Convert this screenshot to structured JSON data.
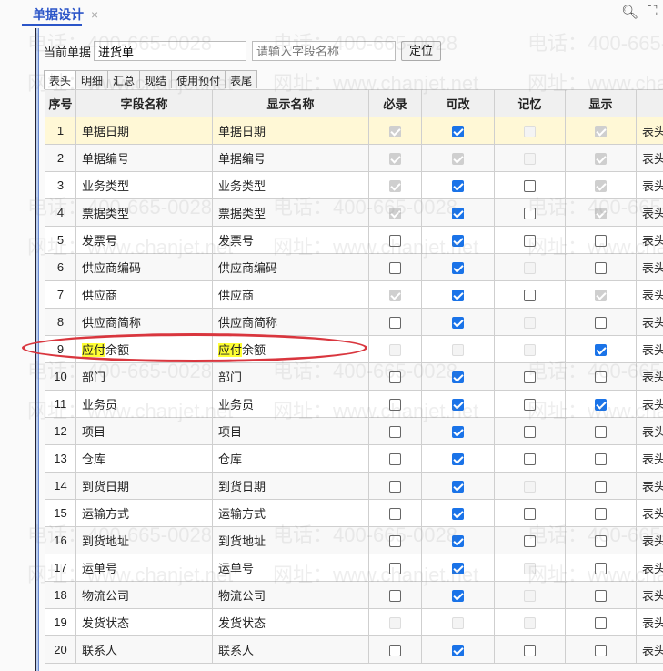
{
  "tab": {
    "title": "单据设计",
    "close": "×"
  },
  "toolbar": {
    "search_icon": "search-icon",
    "fullscreen_icon": "fullscreen-icon"
  },
  "form": {
    "label": "当前单据",
    "doc_value": "进货单",
    "field_placeholder": "请输入字段名称",
    "locate_button": "定位"
  },
  "subtabs": [
    "表头",
    "明细",
    "汇总",
    "现结",
    "使用预付",
    "表尾"
  ],
  "columns": [
    "序号",
    "字段名称",
    "显示名称",
    "必录",
    "可改",
    "记忆",
    "显示",
    ""
  ],
  "rows": [
    {
      "no": "1",
      "field": "单据日期",
      "display": "单据日期",
      "req": "dc",
      "edit": "c",
      "mem": "du",
      "show": "dc",
      "pos": "表头"
    },
    {
      "no": "2",
      "field": "单据编号",
      "display": "单据编号",
      "req": "dc",
      "edit": "dc",
      "mem": "du",
      "show": "dc",
      "pos": "表头"
    },
    {
      "no": "3",
      "field": "业务类型",
      "display": "业务类型",
      "req": "dc",
      "edit": "c",
      "mem": "u",
      "show": "dc",
      "pos": "表头"
    },
    {
      "no": "4",
      "field": "票据类型",
      "display": "票据类型",
      "req": "dc",
      "edit": "c",
      "mem": "u",
      "show": "dc",
      "pos": "表头"
    },
    {
      "no": "5",
      "field": "发票号",
      "display": "发票号",
      "req": "u",
      "edit": "c",
      "mem": "u",
      "show": "u",
      "pos": "表头"
    },
    {
      "no": "6",
      "field": "供应商编码",
      "display": "供应商编码",
      "req": "u",
      "edit": "c",
      "mem": "du",
      "show": "u",
      "pos": "表头"
    },
    {
      "no": "7",
      "field": "供应商",
      "display": "供应商",
      "req": "dc",
      "edit": "c",
      "mem": "u",
      "show": "dc",
      "pos": "表头"
    },
    {
      "no": "8",
      "field": "供应商简称",
      "display": "供应商简称",
      "req": "u",
      "edit": "c",
      "mem": "du",
      "show": "u",
      "pos": "表头"
    },
    {
      "no": "9",
      "field": "应付余额",
      "display": "应付余额",
      "highlight": "应付",
      "req": "du",
      "edit": "du",
      "mem": "du",
      "show": "c",
      "pos": "表头"
    },
    {
      "no": "10",
      "field": "部门",
      "display": "部门",
      "req": "u",
      "edit": "c",
      "mem": "u",
      "show": "u",
      "pos": "表头"
    },
    {
      "no": "11",
      "field": "业务员",
      "display": "业务员",
      "req": "u",
      "edit": "c",
      "mem": "u",
      "show": "c",
      "pos": "表头"
    },
    {
      "no": "12",
      "field": "项目",
      "display": "项目",
      "req": "u",
      "edit": "c",
      "mem": "u",
      "show": "u",
      "pos": "表头"
    },
    {
      "no": "13",
      "field": "仓库",
      "display": "仓库",
      "req": "u",
      "edit": "c",
      "mem": "u",
      "show": "u",
      "pos": "表头"
    },
    {
      "no": "14",
      "field": "到货日期",
      "display": "到货日期",
      "req": "u",
      "edit": "c",
      "mem": "du",
      "show": "u",
      "pos": "表头"
    },
    {
      "no": "15",
      "field": "运输方式",
      "display": "运输方式",
      "req": "u",
      "edit": "c",
      "mem": "u",
      "show": "u",
      "pos": "表头"
    },
    {
      "no": "16",
      "field": "到货地址",
      "display": "到货地址",
      "req": "u",
      "edit": "c",
      "mem": "u",
      "show": "u",
      "pos": "表头"
    },
    {
      "no": "17",
      "field": "运单号",
      "display": "运单号",
      "req": "u",
      "edit": "c",
      "mem": "du",
      "show": "u",
      "pos": "表头"
    },
    {
      "no": "18",
      "field": "物流公司",
      "display": "物流公司",
      "req": "u",
      "edit": "c",
      "mem": "du",
      "show": "u",
      "pos": "表头"
    },
    {
      "no": "19",
      "field": "发货状态",
      "display": "发货状态",
      "req": "du",
      "edit": "du",
      "mem": "du",
      "show": "u",
      "pos": "表头"
    },
    {
      "no": "20",
      "field": "联系人",
      "display": "联系人",
      "req": "u",
      "edit": "c",
      "mem": "u",
      "show": "u",
      "pos": "表头"
    }
  ],
  "watermark": {
    "phone": "电话：400-665-0028",
    "web": "网址：www.chanjet.net"
  },
  "colors": {
    "accent": "#2b55c8",
    "checkbox": "#1a73e8",
    "selected_row": "#fff8d6",
    "annotation": "#d9363e",
    "highlight": "#ffff33"
  }
}
